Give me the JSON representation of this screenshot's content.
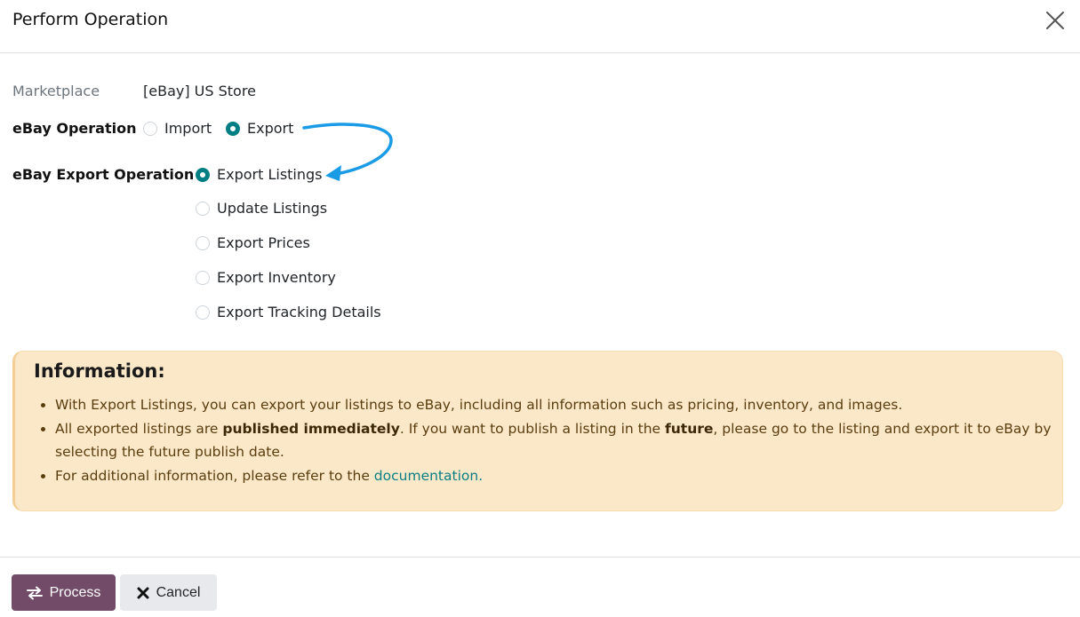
{
  "dialog": {
    "title": "Perform Operation",
    "close_icon": "close-icon"
  },
  "marketplace": {
    "label": "Marketplace",
    "value": "[eBay] US Store"
  },
  "ebay_operation": {
    "label": "eBay Operation",
    "options": [
      {
        "label": "Import",
        "checked": false
      },
      {
        "label": "Export",
        "checked": true
      }
    ]
  },
  "export_operation": {
    "label": "eBay Export Operation",
    "options": [
      {
        "label": "Export Listings",
        "checked": true
      },
      {
        "label": "Update Listings",
        "checked": false
      },
      {
        "label": "Export Prices",
        "checked": false
      },
      {
        "label": "Export Inventory",
        "checked": false
      },
      {
        "label": "Export Tracking Details",
        "checked": false
      }
    ]
  },
  "info": {
    "title": "Information:",
    "item1": "With Export Listings, you can export your listings to eBay, including all information such as pricing, inventory, and images.",
    "item2_a": "All exported listings are ",
    "item2_b": "published immediately",
    "item2_c": ". If you want to publish a listing in the ",
    "item2_d": "future",
    "item2_e": ", please go to the listing and export it to eBay by selecting the future publish date.",
    "item3_a": "For additional information, please refer to the ",
    "item3_link": "documentation."
  },
  "footer": {
    "process_label": "Process",
    "process_icon": "exchange-icon",
    "cancel_label": "Cancel",
    "cancel_icon": "times-icon"
  },
  "colors": {
    "accent": "#017e84",
    "primary_button": "#714b67",
    "info_background": "#fbe8c9",
    "annotation_arrow": "#1a9be6"
  }
}
